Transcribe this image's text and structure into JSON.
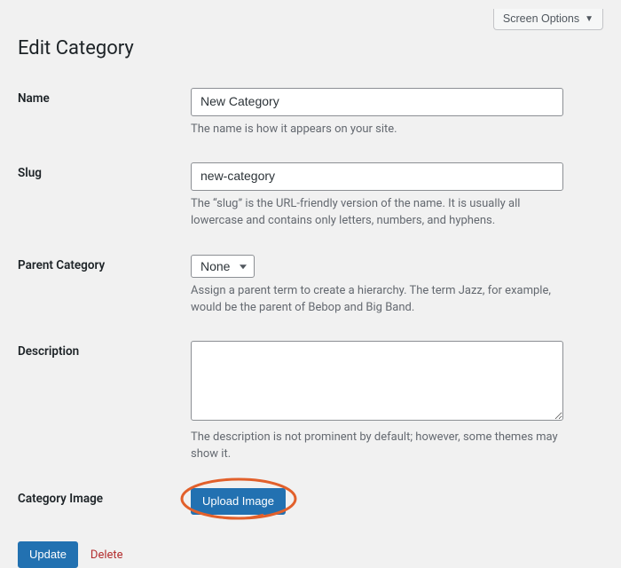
{
  "screen_options": {
    "label": "Screen Options"
  },
  "heading": "Edit Category",
  "fields": {
    "name": {
      "label": "Name",
      "value": "New Category",
      "help": "The name is how it appears on your site."
    },
    "slug": {
      "label": "Slug",
      "value": "new-category",
      "help": "The “slug” is the URL-friendly version of the name. It is usually all lowercase and contains only letters, numbers, and hyphens."
    },
    "parent": {
      "label": "Parent Category",
      "selected": "None",
      "help": "Assign a parent term to create a hierarchy. The term Jazz, for example, would be the parent of Bebop and Big Band."
    },
    "description": {
      "label": "Description",
      "value": "",
      "help": "The description is not prominent by default; however, some themes may show it."
    },
    "image": {
      "label": "Category Image",
      "button": "Upload Image"
    }
  },
  "actions": {
    "update": "Update",
    "delete": "Delete"
  }
}
